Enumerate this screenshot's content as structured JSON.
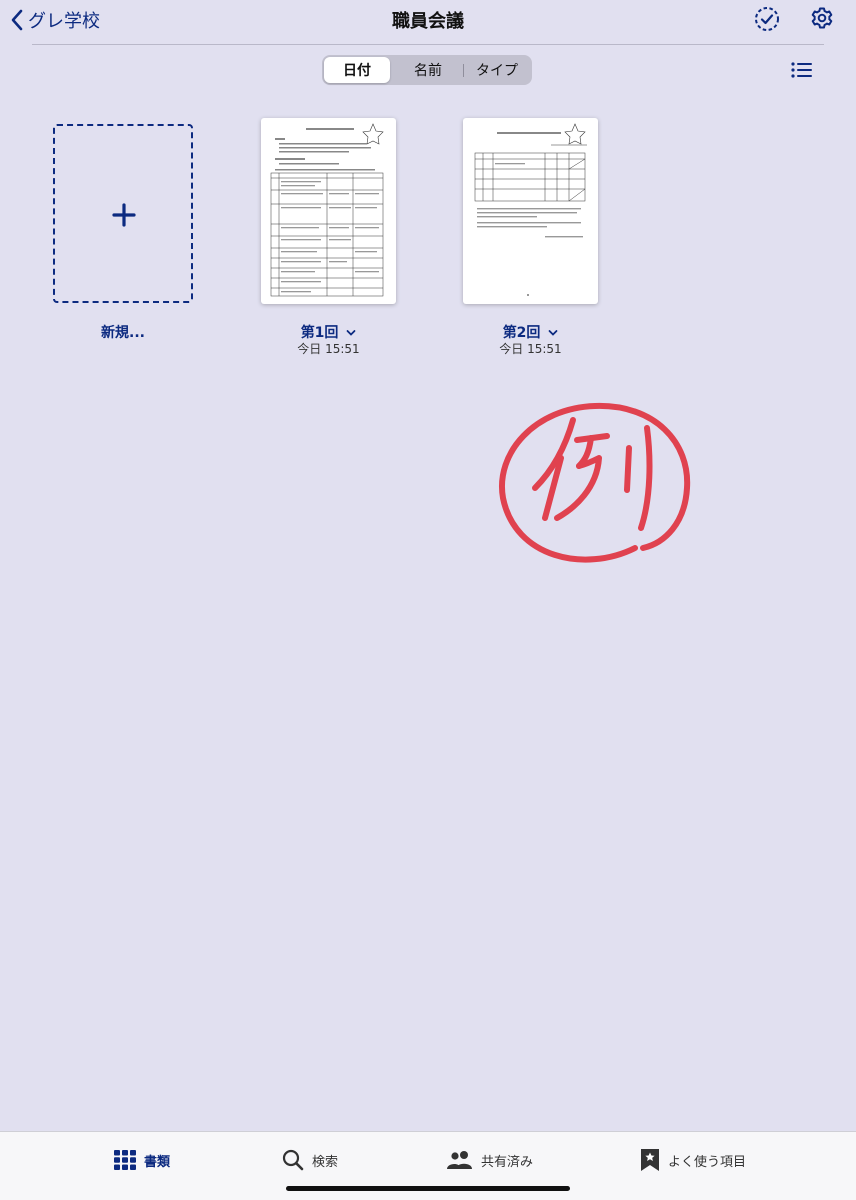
{
  "nav": {
    "back_label": "グレ学校",
    "title": "職員会議"
  },
  "sort": {
    "options": [
      "日付",
      "名前",
      "タイプ"
    ],
    "selected": "日付"
  },
  "new_item": {
    "label": "新規..."
  },
  "documents": [
    {
      "title": "第1回",
      "date": "今日 15:51"
    },
    {
      "title": "第2回",
      "date": "今日 15:51"
    }
  ],
  "tabs": [
    {
      "label": "書類",
      "icon": "grid-icon",
      "active": true
    },
    {
      "label": "検索",
      "icon": "search-icon",
      "active": false
    },
    {
      "label": "共有済み",
      "icon": "people-icon",
      "active": false
    },
    {
      "label": "よく使う項目",
      "icon": "bookmark-star-icon",
      "active": false
    }
  ],
  "colors": {
    "accent": "#0c2a80",
    "background": "#e1e0f0",
    "stamp": "#e0424f"
  }
}
